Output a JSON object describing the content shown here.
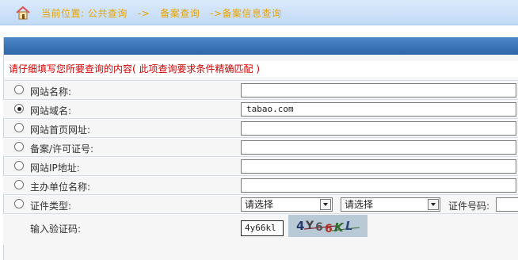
{
  "breadcrumb": {
    "location_label": "当前位置:",
    "item1": "公共查询",
    "sep1": "->",
    "item2": "备案查询",
    "sep2": "->",
    "item3": "备案信息查询"
  },
  "notice": "请仔细填写您所要查询的内容( 此项查询要求条件精确匹配 )",
  "form": {
    "options": [
      {
        "label": "网站名称:",
        "value": "",
        "checked": false
      },
      {
        "label": "网站域名:",
        "value": "tabao.com",
        "checked": true
      },
      {
        "label": "网站首页网址:",
        "value": "",
        "checked": false
      },
      {
        "label": "备案/许可证号:",
        "value": "",
        "checked": false
      },
      {
        "label": "网站IP地址:",
        "value": "",
        "checked": false
      },
      {
        "label": "主办单位名称:",
        "value": "",
        "checked": false
      }
    ],
    "cert_type": {
      "label": "证件类型:",
      "select1": "请选择",
      "select2": "请选择",
      "cert_no_label": "证件号码:"
    },
    "captcha": {
      "label": "输入验证码:",
      "input_value": "4y66kl",
      "image_text": "4Y66KL"
    }
  },
  "colors": {
    "breadcrumb_text": "#e8a200",
    "notice_text": "#d40000",
    "header_bar": "#2d66a8"
  }
}
